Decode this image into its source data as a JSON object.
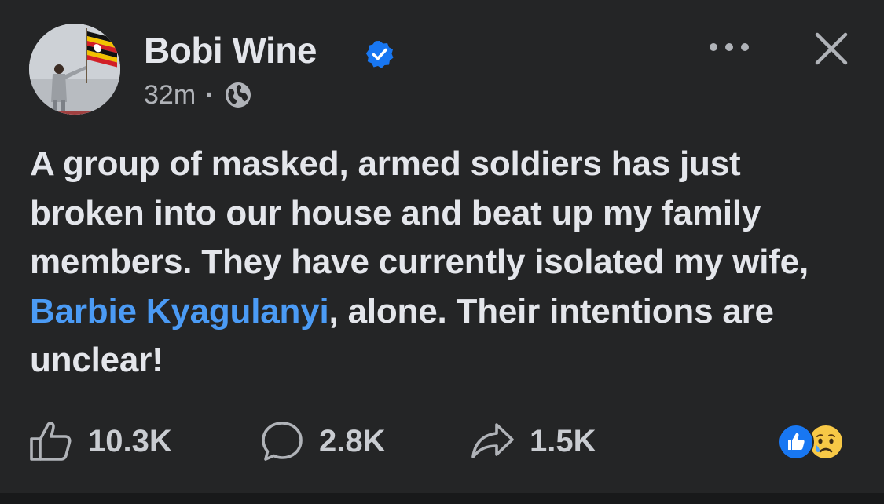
{
  "post": {
    "author": {
      "name": "Bobi Wine",
      "verified": true,
      "avatar_icon": "avatar-photo-flag"
    },
    "meta": {
      "time": "32m",
      "separator": "·",
      "audience_icon": "globe-icon"
    },
    "text": {
      "before_mention": "A group of masked, armed soldiers has just broken into our house and beat up my family members. They have currently isolated my wife, ",
      "mention": "Barbie Kyagulanyi",
      "after_mention": ", alone. Their intentions are unclear!"
    },
    "header_actions": {
      "more_icon": "ellipsis-icon",
      "close_icon": "close-icon"
    },
    "stats": {
      "likes": "10.3K",
      "comments": "2.8K",
      "shares": "1.5K"
    },
    "reactions": [
      "like",
      "sad"
    ]
  },
  "colors": {
    "background": "#242526",
    "text_primary": "#e4e6eb",
    "text_secondary": "#b0b3b8",
    "mention": "#4b9bf5",
    "verified": "#1877f2"
  }
}
